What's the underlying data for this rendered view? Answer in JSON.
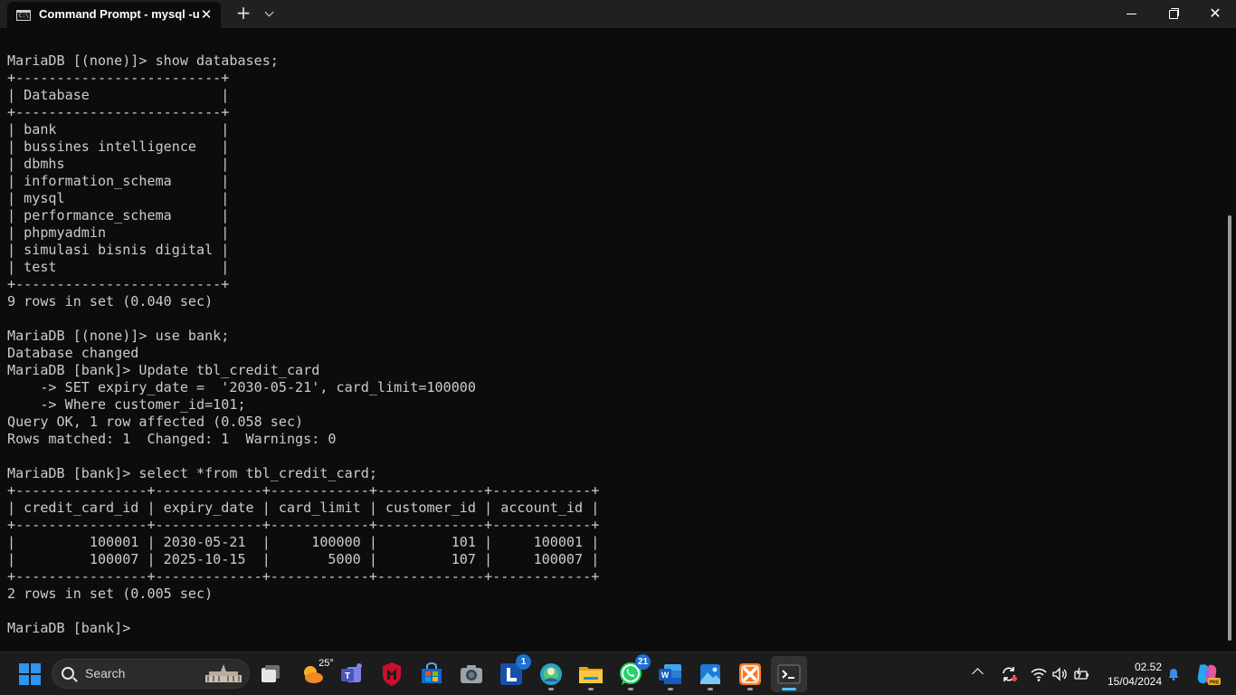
{
  "window": {
    "tab_title": "Command Prompt - mysql  -u",
    "tab_close": "✕",
    "new_tab": "+",
    "close_glyph": "✕"
  },
  "terminal": {
    "lines": [
      "MariaDB [(none)]> show databases;",
      "+-------------------------+",
      "| Database                |",
      "+-------------------------+",
      "| bank                    |",
      "| bussines intelligence   |",
      "| dbmhs                   |",
      "| information_schema      |",
      "| mysql                   |",
      "| performance_schema      |",
      "| phpmyadmin              |",
      "| simulasi bisnis digital |",
      "| test                    |",
      "+-------------------------+",
      "9 rows in set (0.040 sec)",
      "",
      "MariaDB [(none)]> use bank;",
      "Database changed",
      "MariaDB [bank]> Update tbl_credit_card",
      "    -> SET expiry_date =  '2030-05-21', card_limit=100000",
      "    -> Where customer_id=101;",
      "Query OK, 1 row affected (0.058 sec)",
      "Rows matched: 1  Changed: 1  Warnings: 0",
      "",
      "MariaDB [bank]> select *from tbl_credit_card;",
      "+----------------+-------------+------------+-------------+------------+",
      "| credit_card_id | expiry_date | card_limit | customer_id | account_id |",
      "+----------------+-------------+------------+-------------+------------+",
      "|         100001 | 2030-05-21  |     100000 |         101 |     100001 |",
      "|         100007 | 2025-10-15  |       5000 |         107 |     100007 |",
      "+----------------+-------------+------------+-------------+------------+",
      "2 rows in set (0.005 sec)",
      "",
      "MariaDB [bank]> "
    ]
  },
  "taskbar": {
    "search_label": "Search",
    "weather_temp": "25°",
    "launcher_badge": "1",
    "whatsapp_badge": "21",
    "clock_time": "02.52",
    "clock_date": "15/04/2024",
    "accent": "#4cc2ff",
    "icons": [
      "windows-start-icon",
      "search-icon",
      "task-view-icon",
      "weather-icon",
      "teams-icon",
      "mcafee-icon",
      "store-icon",
      "camera-icon",
      "launcher-l-icon",
      "edge-profile-icon",
      "file-explorer-icon",
      "whatsapp-icon",
      "word-icon",
      "photos-icon",
      "xampp-icon",
      "terminal-icon"
    ]
  }
}
